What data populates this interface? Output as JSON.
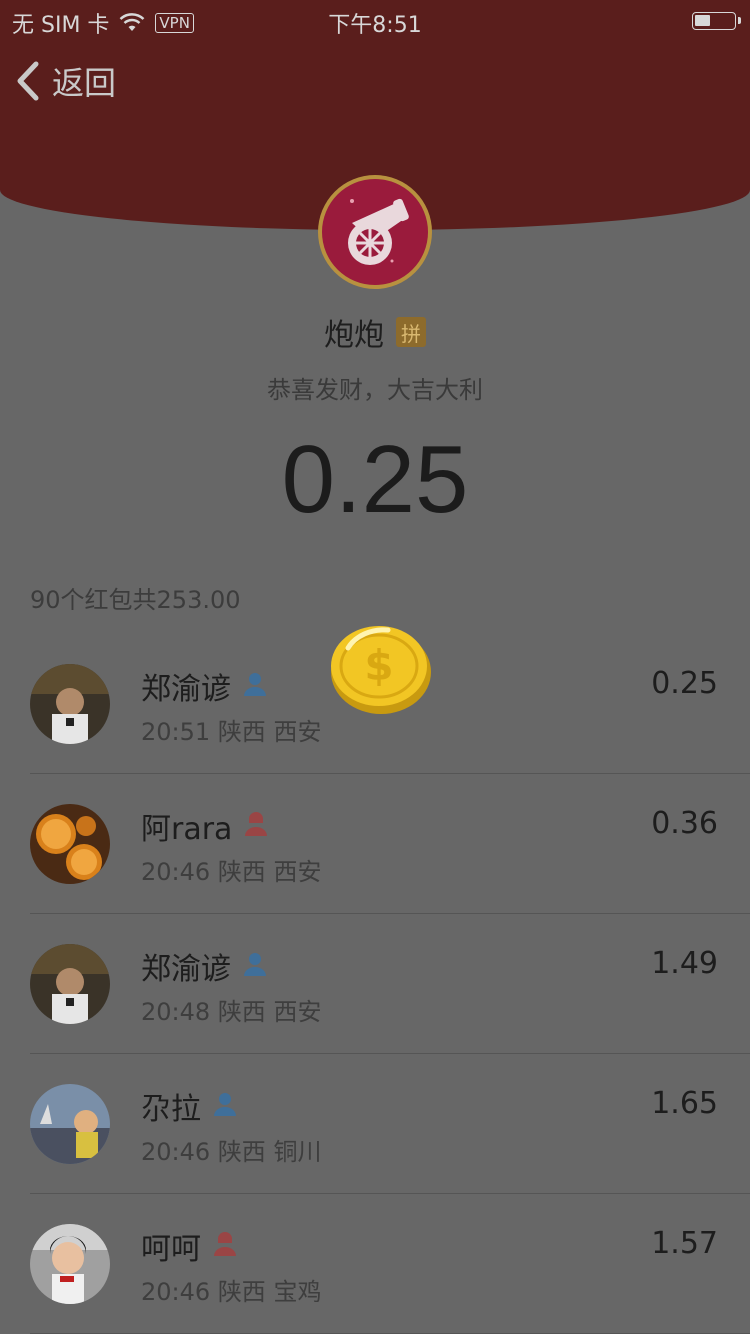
{
  "status_bar": {
    "carrier": "无 SIM 卡",
    "vpn": "VPN",
    "time": "下午8:51"
  },
  "nav": {
    "back_label": "返回"
  },
  "packet": {
    "sender": "炮炮",
    "type_badge": "拼",
    "greeting": "恭喜发财，大吉大利",
    "my_amount": "0.25",
    "summary": "90个红包共253.00"
  },
  "recipients": [
    {
      "name": "郑渝谚",
      "gender": "male",
      "time": "20:51",
      "province": "陕西",
      "city": "西安",
      "amount": "0.25"
    },
    {
      "name": "阿rara",
      "gender": "female",
      "time": "20:46",
      "province": "陕西",
      "city": "西安",
      "amount": "0.36"
    },
    {
      "name": "郑渝谚",
      "gender": "male",
      "time": "20:48",
      "province": "陕西",
      "city": "西安",
      "amount": "1.49"
    },
    {
      "name": "尕拉",
      "gender": "male",
      "time": "20:46",
      "province": "陕西",
      "city": "铜川",
      "amount": "1.65"
    },
    {
      "name": "呵呵",
      "gender": "female",
      "time": "20:46",
      "province": "陕西",
      "city": "宝鸡",
      "amount": "1.57"
    }
  ],
  "colors": {
    "header": "#5a1e1c",
    "overlay_bg": "#676767",
    "male_icon": "#3f6f9a",
    "female_icon": "#9a4545"
  }
}
